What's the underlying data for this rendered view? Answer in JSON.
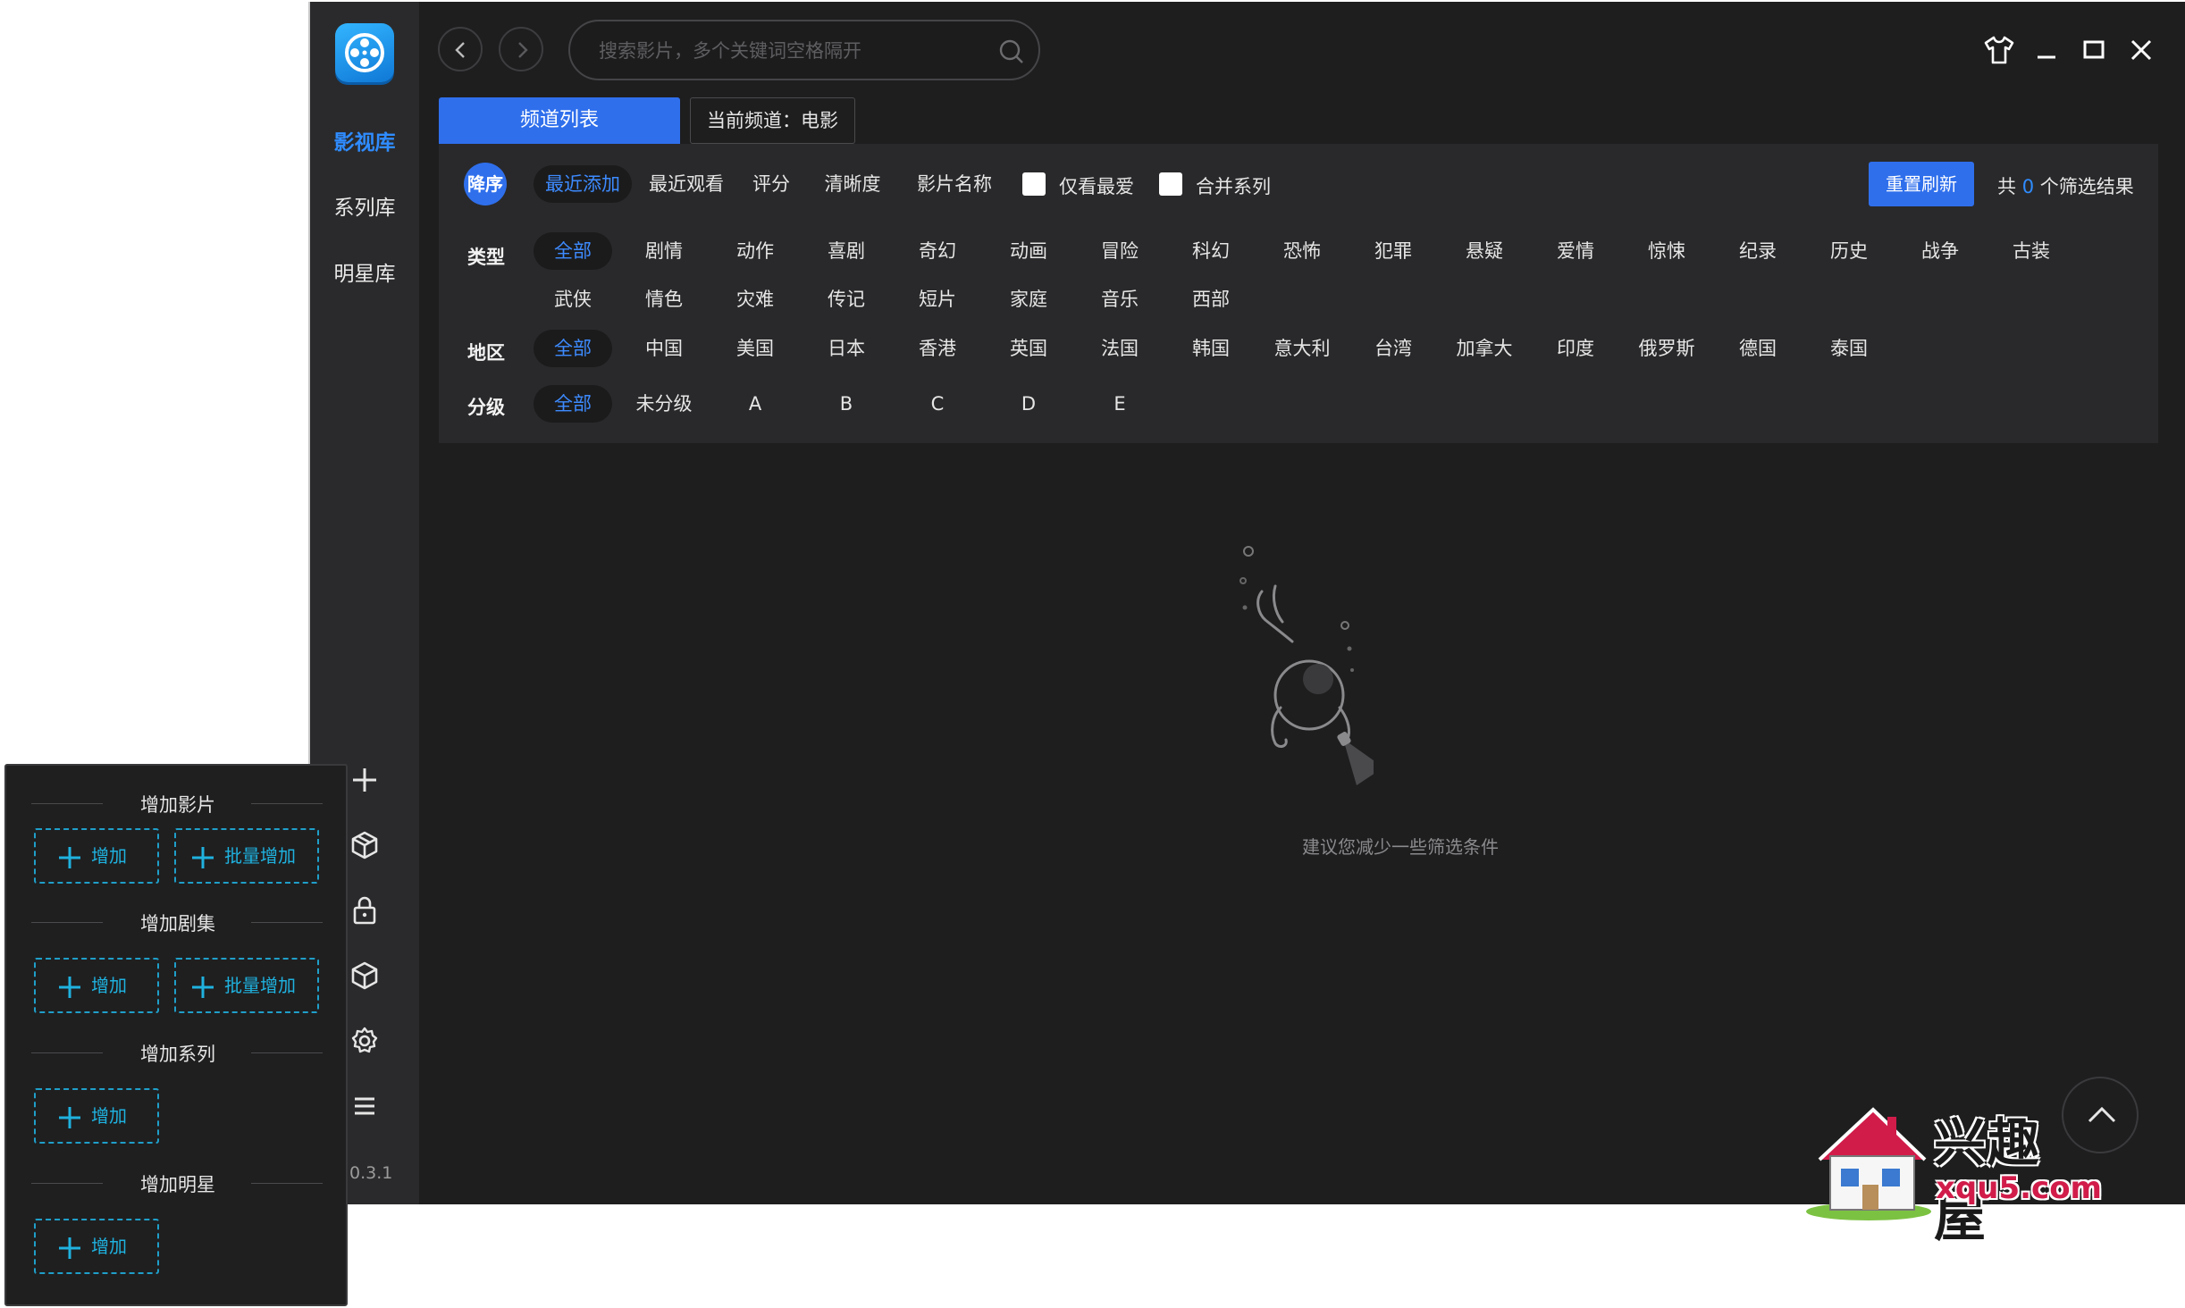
{
  "sidebar": {
    "nav": [
      "影视库",
      "系列库",
      "明星库"
    ],
    "version": ".0.3.1"
  },
  "topbar": {
    "search_placeholder": "搜索影片，多个关键词空格隔开"
  },
  "tabs": {
    "active": "频道列表",
    "current": "当前频道：电影"
  },
  "filter": {
    "sort_label": "降序",
    "sort_options": [
      "最近添加",
      "最近观看",
      "评分",
      "清晰度",
      "影片名称"
    ],
    "favorite_only": "仅看最爱",
    "merge_series": "合并系列",
    "reset": "重置刷新",
    "result_prefix": "共",
    "result_count": "0",
    "result_suffix": "个筛选结果",
    "genre_label": "类型",
    "genres_row1": [
      "全部",
      "剧情",
      "动作",
      "喜剧",
      "奇幻",
      "动画",
      "冒险",
      "科幻",
      "恐怖",
      "犯罪",
      "悬疑",
      "爱情",
      "惊悚",
      "纪录",
      "历史",
      "战争",
      "古装"
    ],
    "genres_row2": [
      "武侠",
      "情色",
      "灾难",
      "传记",
      "短片",
      "家庭",
      "音乐",
      "西部"
    ],
    "region_label": "地区",
    "regions": [
      "全部",
      "中国",
      "美国",
      "日本",
      "香港",
      "英国",
      "法国",
      "韩国",
      "意大利",
      "台湾",
      "加拿大",
      "印度",
      "俄罗斯",
      "德国",
      "泰国"
    ],
    "rating_label": "分级",
    "ratings": [
      "全部",
      "未分级",
      "A",
      "B",
      "C",
      "D",
      "E"
    ]
  },
  "empty": {
    "text": "建议您减少一些筛选条件"
  },
  "watermark": {
    "title": "兴趣屋",
    "url": "xqu5.com"
  },
  "add_panel": {
    "sections": [
      {
        "title": "增加影片",
        "add": "增加",
        "batch": "批量增加"
      },
      {
        "title": "增加剧集",
        "add": "增加",
        "batch": "批量增加"
      },
      {
        "title": "增加系列",
        "add": "增加"
      },
      {
        "title": "增加明星",
        "add": "增加"
      }
    ]
  },
  "colors": {
    "accent": "#2f6fec",
    "link_blue": "#3d8bff",
    "dashed_cyan": "#1f9fc9",
    "background": "#1e1e1f",
    "panel": "#29292b"
  },
  "icons": [
    "app-logo-icon",
    "back-icon",
    "forward-icon",
    "search-icon",
    "skin-icon",
    "minimize-icon",
    "maximize-icon",
    "close-icon",
    "plus-icon",
    "box-icon",
    "lock-icon",
    "cube-icon",
    "gear-icon",
    "menu-icon",
    "scroll-top-icon"
  ]
}
